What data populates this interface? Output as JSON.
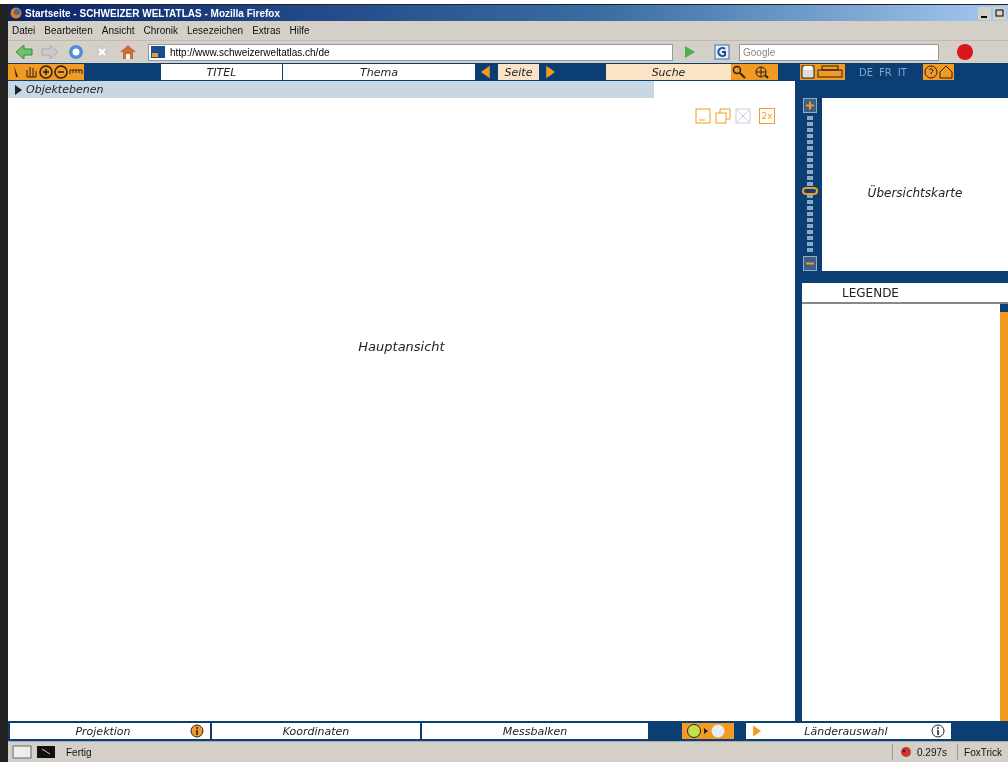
{
  "window": {
    "title": "Startseite - SCHWEIZER WELTATLAS - Mozilla Firefox"
  },
  "menu": [
    "Datei",
    "Bearbeiten",
    "Ansicht",
    "Chronik",
    "Lesezeichen",
    "Extras",
    "Hilfe"
  ],
  "address": {
    "value": "http://www.schweizerweltatlas.ch/de"
  },
  "search": {
    "placeholder": "Google"
  },
  "toolbar": {
    "title": "TITEL",
    "theme": "Thema",
    "page": "Seite",
    "search": "Suche",
    "languages": [
      "DE",
      "FR",
      "IT"
    ]
  },
  "layers": {
    "label": "Objektebenen",
    "expanded": false
  },
  "main_view": {
    "label": "Hauptansicht",
    "zoom_badge": "2x"
  },
  "overview": {
    "label": "Übersichtskarte",
    "zoom": {
      "level": 0.45
    }
  },
  "legend": {
    "title": "LEGENDE"
  },
  "bottom": {
    "projection": "Projektion",
    "coordinates": "Koordinaten",
    "scale_bar": "Messbalken",
    "country_select": "Länderauswahl"
  },
  "status_bar": {
    "text": "Fertig",
    "timing": "0.297s",
    "extension": "FoxTrick"
  }
}
